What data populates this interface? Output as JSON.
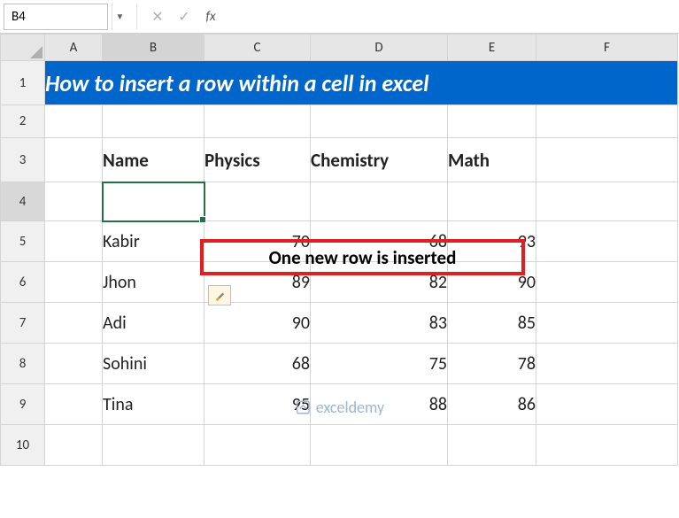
{
  "chart_data": {
    "type": "table",
    "title": "How to insert a row within a cell in excel",
    "headers": [
      "Name",
      "Physics",
      "Chemistry",
      "Math"
    ],
    "rows": [
      {
        "name": "Kabir",
        "physics": 70,
        "chemistry": 68,
        "math": 93
      },
      {
        "name": "Jhon",
        "physics": 89,
        "chemistry": 82,
        "math": 90
      },
      {
        "name": "Adi",
        "physics": 90,
        "chemistry": 83,
        "math": 85
      },
      {
        "name": "Sohini",
        "physics": 68,
        "chemistry": 75,
        "math": 78
      },
      {
        "name": "Tina",
        "physics": 95,
        "chemistry": 88,
        "math": 86
      }
    ],
    "annotation": "One new row is inserted"
  },
  "nameBox": "B4",
  "formulaBar": "",
  "columns": [
    "A",
    "B",
    "C",
    "D",
    "E",
    "F"
  ],
  "rowNumbers": [
    "1",
    "2",
    "3",
    "4",
    "5",
    "6",
    "7",
    "8",
    "9",
    "10"
  ],
  "title": "How to insert a row within a cell in excel",
  "headers": {
    "name": "Name",
    "physics": "Physics",
    "chemistry": "Chemistry",
    "math": "Math"
  },
  "callout": "One new row is inserted",
  "data": {
    "r5": {
      "name": "Kabir",
      "physics": "70",
      "chemistry": "68",
      "math": "93"
    },
    "r6": {
      "name": "Jhon",
      "physics": "89",
      "chemistry": "82",
      "math": "90"
    },
    "r7": {
      "name": "Adi",
      "physics": "90",
      "chemistry": "83",
      "math": "85"
    },
    "r8": {
      "name": "Sohini",
      "physics": "68",
      "chemistry": "75",
      "math": "78"
    },
    "r9": {
      "name": "Tina",
      "physics": "95",
      "chemistry": "88",
      "math": "86"
    }
  },
  "watermark": "exceldemy"
}
